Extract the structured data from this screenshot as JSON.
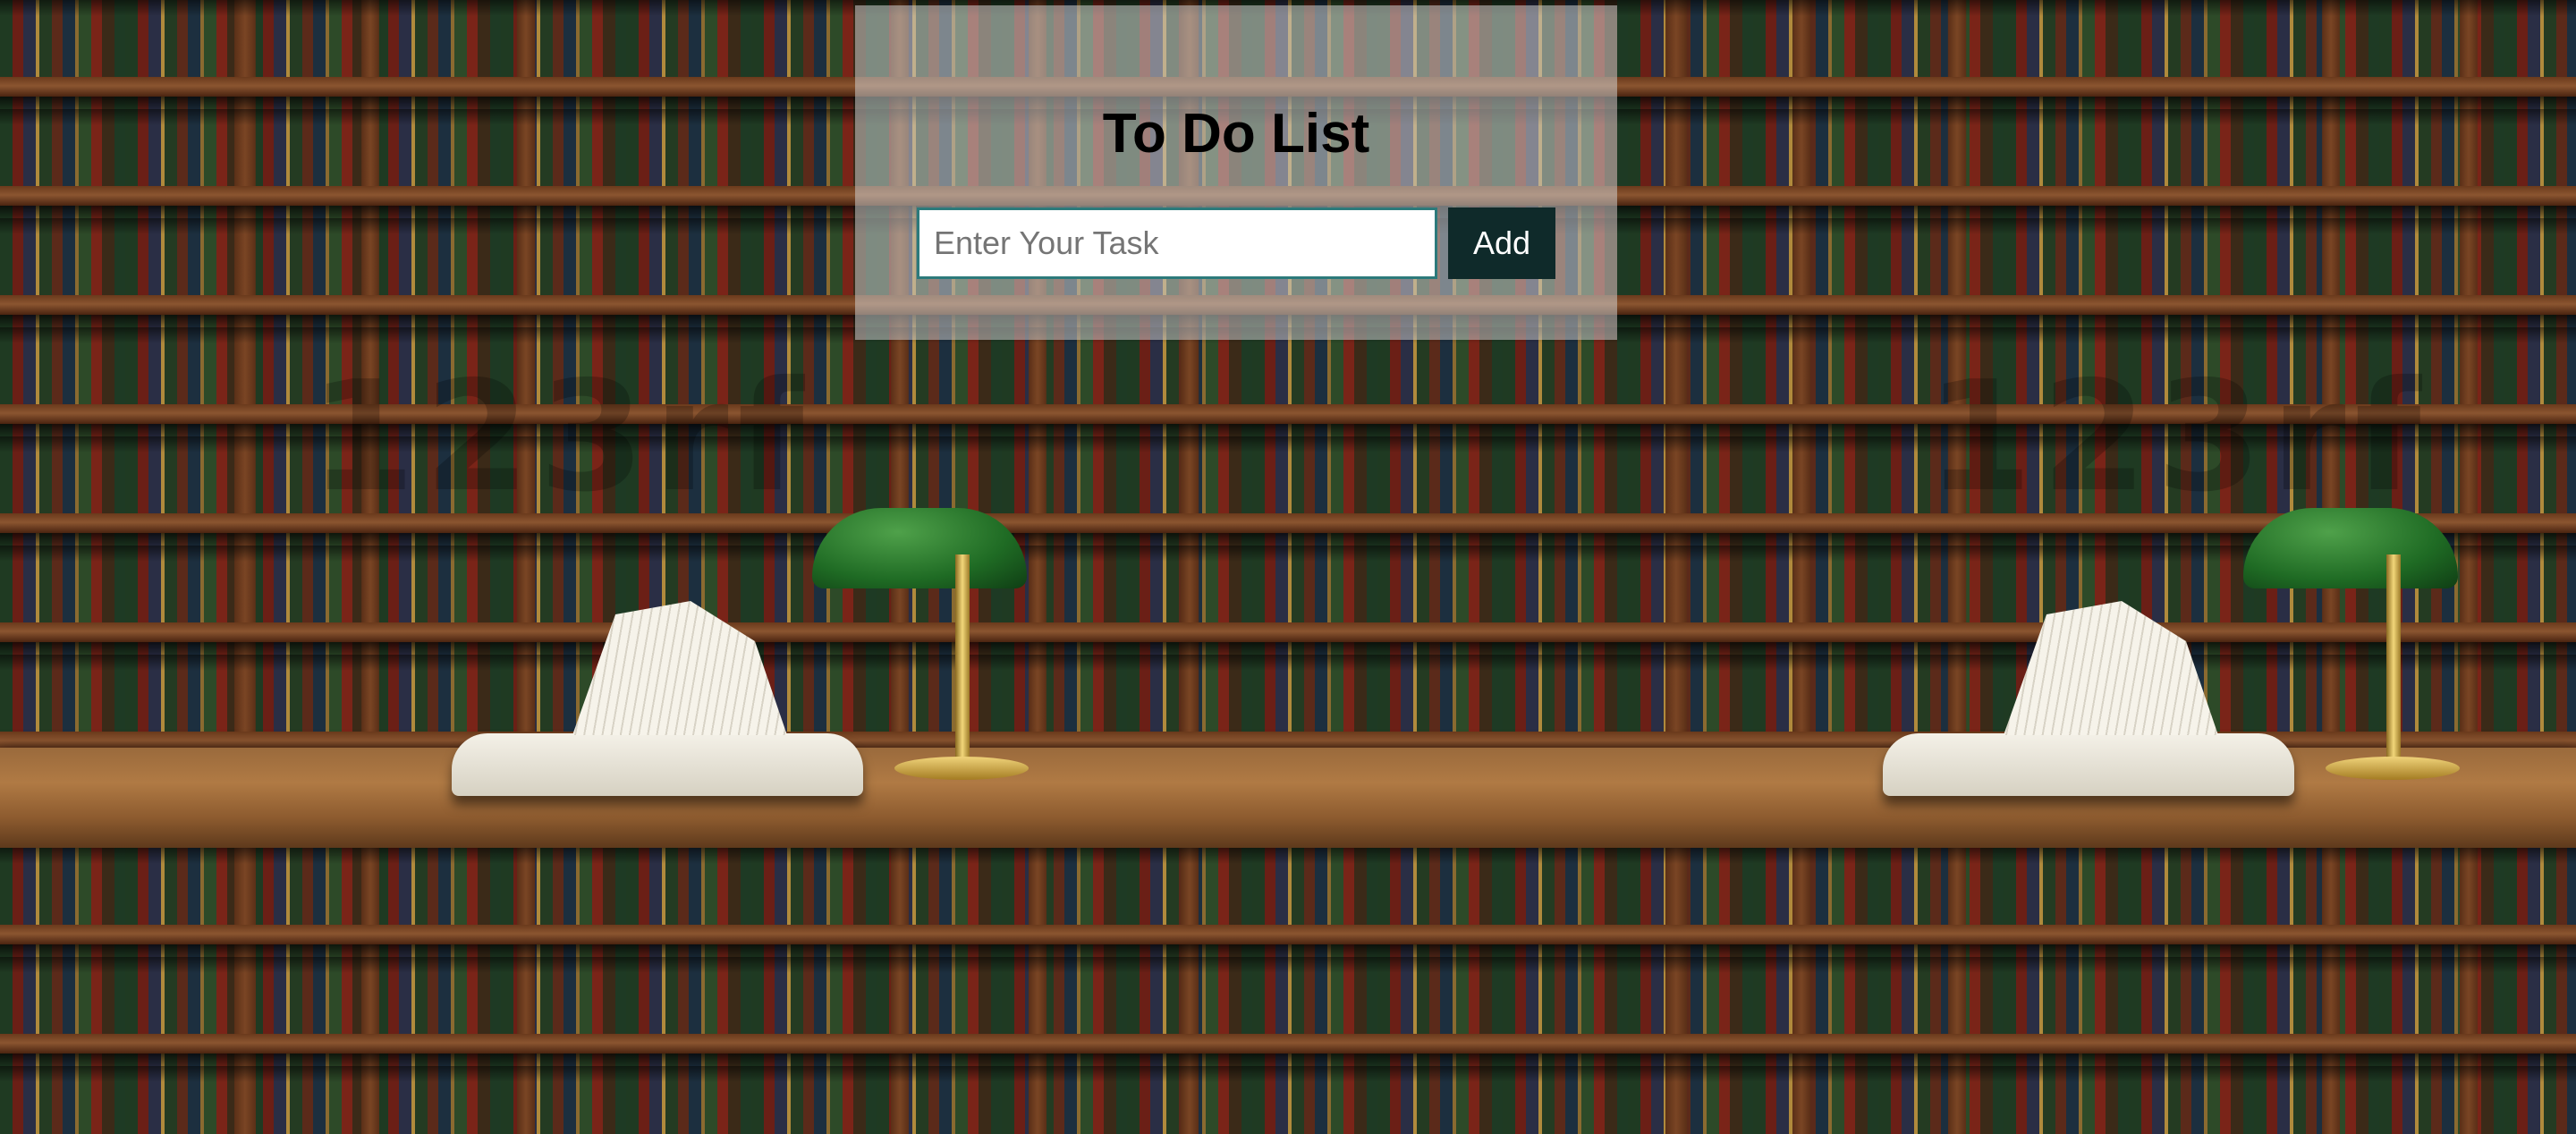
{
  "page": {
    "background": "library bookshelf photo",
    "watermark": "123rf"
  },
  "todo": {
    "title": "To Do List",
    "input_placeholder": "Enter Your Task",
    "input_value": "",
    "add_label": "Add"
  },
  "colors": {
    "card_bg": "#cdcdcd",
    "input_border": "#2c7a7b",
    "button_bg": "#0f2a2a",
    "button_text": "#ffffff"
  }
}
